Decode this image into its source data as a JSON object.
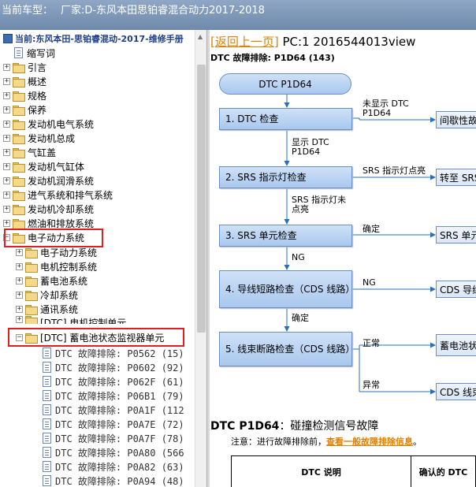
{
  "header": {
    "model_label": "当前车型：",
    "vendor": "厂家:D-东风本田思铂睿混合动力2017-2018"
  },
  "tree": {
    "root": "当前:东风本田-思铂睿混动-2017-维修手册",
    "items": [
      {
        "label": "缩写词",
        "type": "doc"
      },
      {
        "label": "引言",
        "type": "folder"
      },
      {
        "label": "概述",
        "type": "folder"
      },
      {
        "label": "规格",
        "type": "folder"
      },
      {
        "label": "保养",
        "type": "folder"
      },
      {
        "label": "发动机电气系统",
        "type": "folder"
      },
      {
        "label": "发动机总成",
        "type": "folder"
      },
      {
        "label": "气缸盖",
        "type": "folder"
      },
      {
        "label": "发动机气缸体",
        "type": "folder"
      },
      {
        "label": "发动机润滑系统",
        "type": "folder"
      },
      {
        "label": "进气系统和排气系统",
        "type": "folder"
      },
      {
        "label": "发动机冷却系统",
        "type": "folder"
      },
      {
        "label": "燃油和排放系统",
        "type": "folder"
      },
      {
        "label": "电子动力系统",
        "type": "folder",
        "expanded": true
      }
    ],
    "children": [
      {
        "label": "电子动力系统"
      },
      {
        "label": "电机控制系统"
      },
      {
        "label": "蓄电池系统"
      },
      {
        "label": "冷却系统"
      },
      {
        "label": "通讯系统"
      },
      {
        "label": "[DTC] 电机控制单元"
      },
      {
        "label": "[DTC] 蓄电池状态监视器单元",
        "expanded": true
      }
    ],
    "dtc_items": [
      "DTC 故障排除: P0562 (15)",
      "DTC 故障排除: P0602 (92)",
      "DTC 故障排除: P062F (61)",
      "DTC 故障排除: P06B1 (79)",
      "DTC 故障排除: P0A1F (112",
      "DTC 故障排除: P0A7E (72)",
      "DTC 故障排除: P0A7F (78)",
      "DTC 故障排除: P0A80 (566",
      "DTC 故障排除: P0A82 (63)",
      "DTC 故障排除: P0A94 (48)"
    ]
  },
  "content": {
    "back_link": "返回上一页",
    "bracket_open": "[",
    "bracket_close": "]",
    "page_id": "PC:1 2016544013view",
    "subheading": "DTC 故障排除: P1D64 (143)",
    "flow": {
      "start": "DTC P1D64",
      "steps": [
        "1.  DTC 检查",
        "2.  SRS 指示灯检查",
        "3.  SRS 单元检查",
        "4.  导线短路检查（CDS 线路）",
        "5.  线束断路检查（CDS 线路）"
      ],
      "side_boxes": [
        "间歇性故障",
        "转至 SRS",
        "SRS 单元",
        "CDS 导线",
        "蓄电池状",
        "CDS 线束"
      ],
      "edge_labels": {
        "not_shown": "未显示 DTC P1D64",
        "shown": "显示 DTC P1D64",
        "srs_on": "SRS 指示灯点亮",
        "srs_off": "SRS 指示灯未点亮",
        "ok1": "确定",
        "ng1": "NG",
        "ng2": "NG",
        "ok2": "确定",
        "normal": "正常",
        "abnormal": "异常"
      }
    },
    "section_title_code": "DTC P1D64",
    "section_title_desc": "：碰撞检测信号故障",
    "note_prefix": "注意：进行故障排除前，",
    "note_link": "查看一般故障排除信息",
    "note_suffix": "。",
    "table_headers": [
      "DTC 说明",
      "确认的 DTC"
    ]
  }
}
